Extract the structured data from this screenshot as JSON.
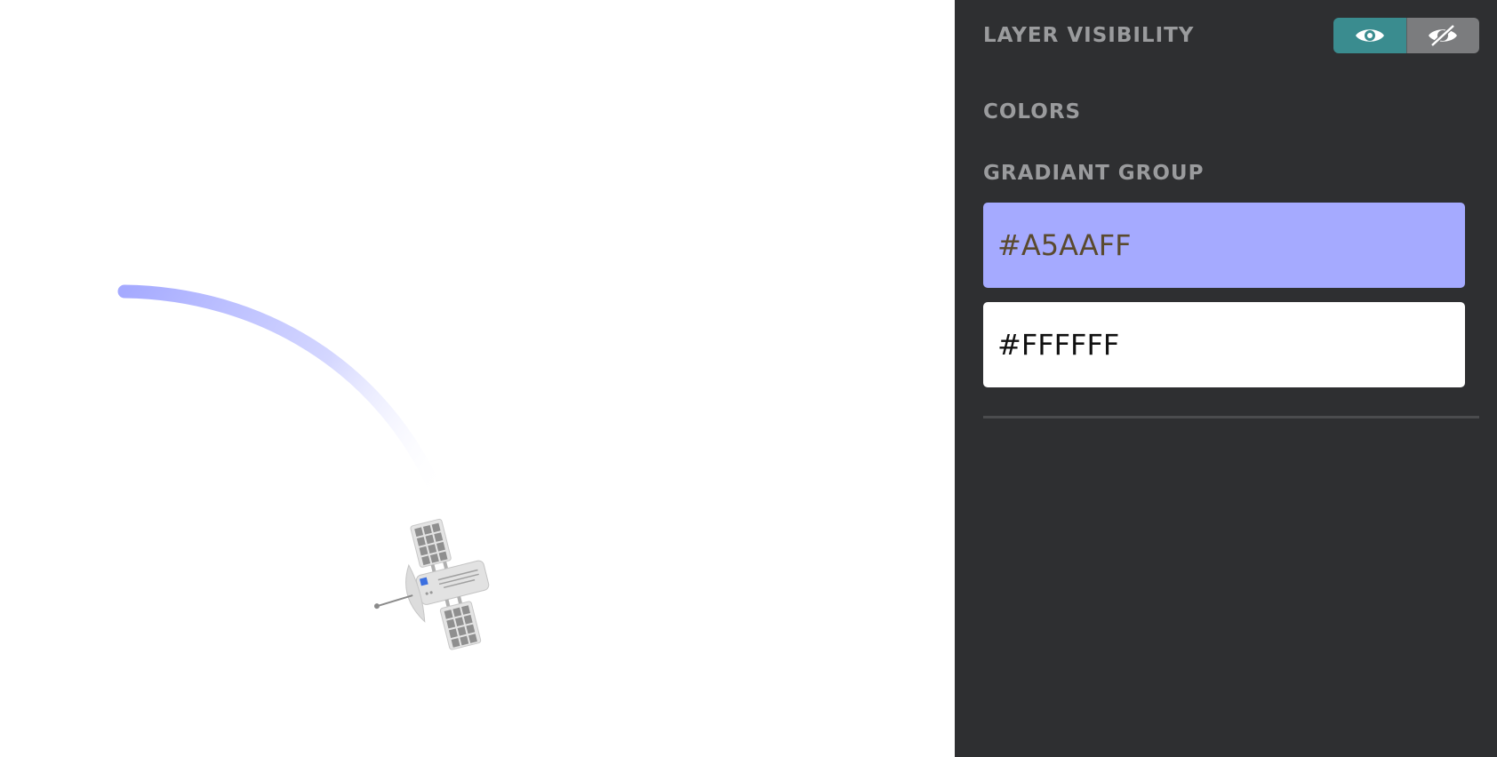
{
  "panel": {
    "layer_visibility_label": "LAYER VISIBILITY",
    "colors_label": "COLORS",
    "gradient_group_label": "GRADIANT GROUP",
    "visibility_toggle": {
      "selected": "visible",
      "options": [
        {
          "id": "visible",
          "icon": "eye-icon"
        },
        {
          "id": "hidden",
          "icon": "eye-slash-icon"
        }
      ]
    },
    "swatches": [
      {
        "hex": "#A5AAFF",
        "text_color": "#5a4a2e"
      },
      {
        "hex": "#FFFFFF",
        "text_color": "#111111"
      }
    ]
  },
  "canvas": {
    "arc_gradient_start": "#A5AAFF",
    "arc_gradient_end": "#FFFFFF",
    "object_icon": "satellite-icon"
  },
  "colors": {
    "panel_bg": "#2e2f31",
    "label": "#9a9b9d",
    "toggle_active": "#3a8c8f",
    "toggle_inactive": "#7b7c7e"
  }
}
